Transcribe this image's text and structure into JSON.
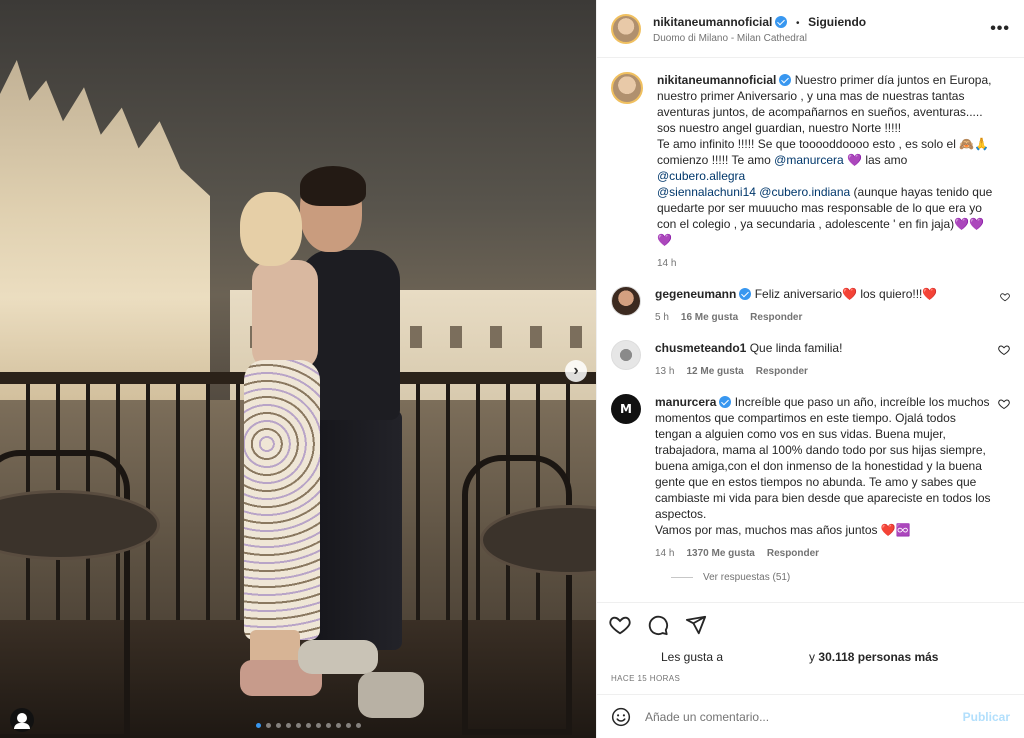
{
  "post": {
    "username": "nikitaneumannoficial",
    "follow_status": "Siguiendo",
    "follow_separator": "•",
    "location": "Duomo di Milano - Milan Cathedral",
    "more_label": "•••"
  },
  "caption": {
    "username": "nikitaneumannoficial",
    "text_part1": "Nuestro primer día juntos en Europa, nuestro primer Aniversario , y una mas de nuestras tantas aventuras juntos, de acompañarnos en sueños, aventuras..... sos nuestro angel guardian, nuestro Norte !!!!!\nTe amo infinito !!!!! Se que tooooddoooo esto , es solo el 🙈🙏 comienzo !!!!! Te amo ",
    "mention1": "@manurcera",
    "text_part2": " 💜 las amo ",
    "mention2": "@cubero.allegra",
    "mention3": "@siennalachuni14",
    "mention4": "@cubero.indiana",
    "text_part3": " (aunque hayas tenido que quedarte por ser muuucho mas responsable de lo que era yo con el colegio , ya secundaria , adolescente ' en fin jaja)💜💜💜",
    "time": "14 h"
  },
  "comments": [
    {
      "username": "gegeneumann",
      "text": "Feliz aniversario❤️ los quiero!!!❤️",
      "time": "5 h",
      "likes": "16 Me gusta",
      "reply": "Responder"
    },
    {
      "username": "chusmeteando1",
      "text": "Que linda familia!",
      "time": "13 h",
      "likes": "12 Me gusta",
      "reply": "Responder"
    },
    {
      "username": "manurcera",
      "text": "Increíble que paso un año, increíble los muchos momentos que compartimos en este tiempo. Ojalá todos tengan a alguien como vos en sus vidas. Buena mujer, trabajadora, mama al 100% dando todo por sus hijas siempre, buena amiga,con el don inmenso de la honestidad y la buena gente que en estos tiempos no abunda. Te amo y sabes que cambiaste mi vida para bien desde que apareciste en todos los aspectos.\nVamos por mas, muchos mas años juntos ❤️♾️",
      "time": "14 h",
      "likes": "1370 Me gusta",
      "reply": "Responder",
      "view_replies": "Ver respuestas (51)"
    }
  ],
  "likes": {
    "prefix": "Les gusta a",
    "suffix": "y",
    "count": "30.118 personas más"
  },
  "post_time": "HACE 15 HORAS",
  "composer": {
    "placeholder": "Añade un comentario...",
    "publish": "Publicar"
  },
  "carousel": {
    "total": 11,
    "active": 1
  },
  "colors": {
    "verified": "#3897f0",
    "link": "#00376b",
    "publish": "#b2dffc"
  }
}
